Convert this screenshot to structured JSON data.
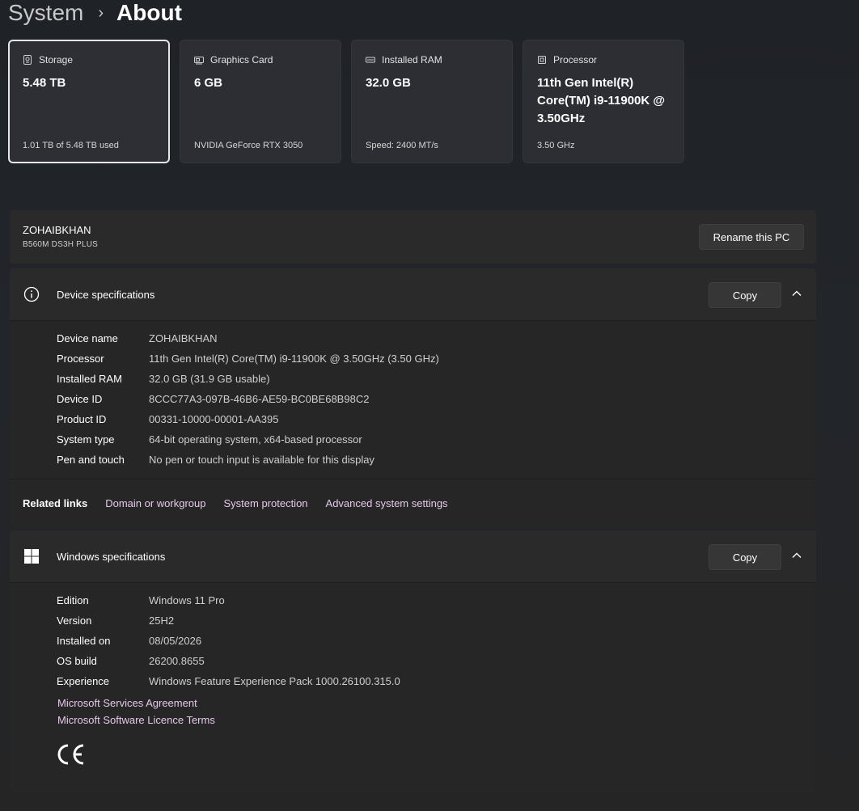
{
  "breadcrumb": {
    "parent": "System",
    "separator": "›",
    "current": "About"
  },
  "cards": [
    {
      "icon": "storage-icon",
      "title": "Storage",
      "value": "5.48 TB",
      "sub": "1.01 TB of 5.48 TB used",
      "selected": true
    },
    {
      "icon": "graphics-card-icon",
      "title": "Graphics Card",
      "value": "6 GB",
      "sub": "NVIDIA GeForce RTX 3050",
      "selected": false
    },
    {
      "icon": "ram-icon",
      "title": "Installed RAM",
      "value": "32.0 GB",
      "sub": "Speed: 2400 MT/s",
      "selected": false
    },
    {
      "icon": "processor-icon",
      "title": "Processor",
      "value": "11th Gen Intel(R) Core(TM) i9-11900K @ 3.50GHz",
      "sub": "3.50 GHz",
      "selected": false
    }
  ],
  "pc": {
    "name": "ZOHAIBKHAN",
    "model": "B560M DS3H PLUS",
    "rename_label": "Rename this PC"
  },
  "device_specs": {
    "title": "Device specifications",
    "copy_label": "Copy",
    "rows": [
      {
        "label": "Device name",
        "value": "ZOHAIBKHAN"
      },
      {
        "label": "Processor",
        "value": "11th Gen Intel(R) Core(TM) i9-11900K @ 3.50GHz (3.50 GHz)"
      },
      {
        "label": "Installed RAM",
        "value": "32.0 GB (31.9 GB usable)"
      },
      {
        "label": "Device ID",
        "value": "8CCC77A3-097B-46B6-AE59-BC0BE68B98C2"
      },
      {
        "label": "Product ID",
        "value": "00331-10000-00001-AA395"
      },
      {
        "label": "System type",
        "value": "64-bit operating system, x64-based processor"
      },
      {
        "label": "Pen and touch",
        "value": "No pen or touch input is available for this display"
      }
    ]
  },
  "related_links": {
    "label": "Related links",
    "links": [
      "Domain or workgroup",
      "System protection",
      "Advanced system settings"
    ]
  },
  "windows_specs": {
    "title": "Windows specifications",
    "copy_label": "Copy",
    "rows": [
      {
        "label": "Edition",
        "value": "Windows 11 Pro"
      },
      {
        "label": "Version",
        "value": "25H2"
      },
      {
        "label": "Installed on",
        "value": "08/05/2026"
      },
      {
        "label": "OS build",
        "value": "26200.8655"
      },
      {
        "label": "Experience",
        "value": "Windows Feature Experience Pack 1000.26100.315.0"
      }
    ],
    "links": [
      "Microsoft Services Agreement",
      "Microsoft Software Licence Terms"
    ]
  },
  "colors": {
    "background": "#202020",
    "panel": "#2a2a2a",
    "link": "#e4c8e8",
    "selected_border": "#e6e6e6"
  }
}
